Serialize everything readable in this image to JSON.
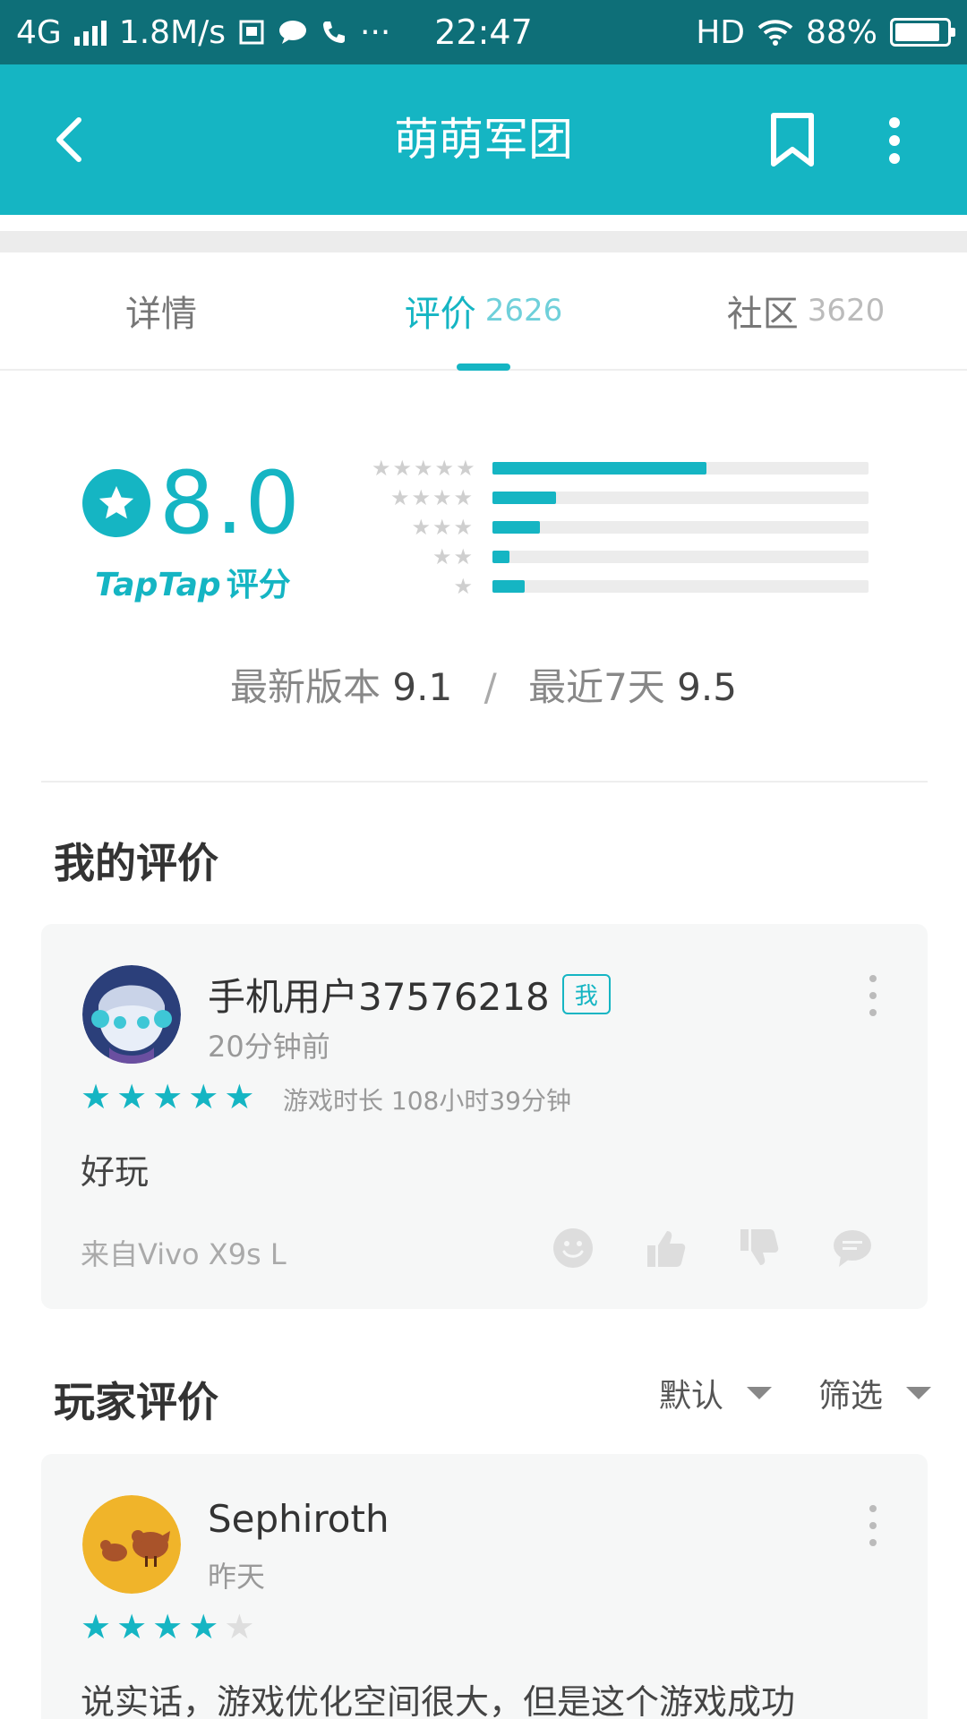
{
  "status_bar": {
    "network": "4G",
    "speed": "1.8M/s",
    "more": "···",
    "time": "22:47",
    "hd": "HD",
    "battery": "88%",
    "battery_level": 0.88
  },
  "app_bar": {
    "title": "萌萌军团"
  },
  "tabs": [
    {
      "label": "详情",
      "count": ""
    },
    {
      "label": "评价",
      "count": "2626"
    },
    {
      "label": "社区",
      "count": "3620"
    }
  ],
  "rating": {
    "score": "8.0",
    "brand": "TapTap",
    "label": "评分",
    "distribution": [
      {
        "stars": "★★★★★",
        "fraction": 0.57
      },
      {
        "stars": "★★★★",
        "fraction": 0.17
      },
      {
        "stars": "★★★",
        "fraction": 0.125
      },
      {
        "stars": "★★",
        "fraction": 0.045
      },
      {
        "stars": "★",
        "fraction": 0.085
      }
    ],
    "latest_version_label": "最新版本",
    "latest_version_score": "9.1",
    "separator": "/",
    "recent_label": "最近7天",
    "recent_score": "9.5"
  },
  "my_review": {
    "section_title": "我的评价",
    "user": "手机用户37576218",
    "badge": "我",
    "time": "20分钟前",
    "rating": 5,
    "playtime": "游戏时长 108小时39分钟",
    "text": "好玩",
    "device": "来自Vivo X9s L"
  },
  "player_reviews": {
    "section_title": "玩家评价",
    "sort_label": "默认",
    "filter_label": "筛选",
    "first": {
      "user": "Sephiroth",
      "time": "昨天",
      "rating": 4,
      "text": "说实话，游戏优化空间很大，但是这个游戏成功"
    }
  },
  "colors": {
    "accent": "#15b5c3",
    "status_bar": "#0e6f78",
    "card_bg": "#f6f7f7"
  }
}
